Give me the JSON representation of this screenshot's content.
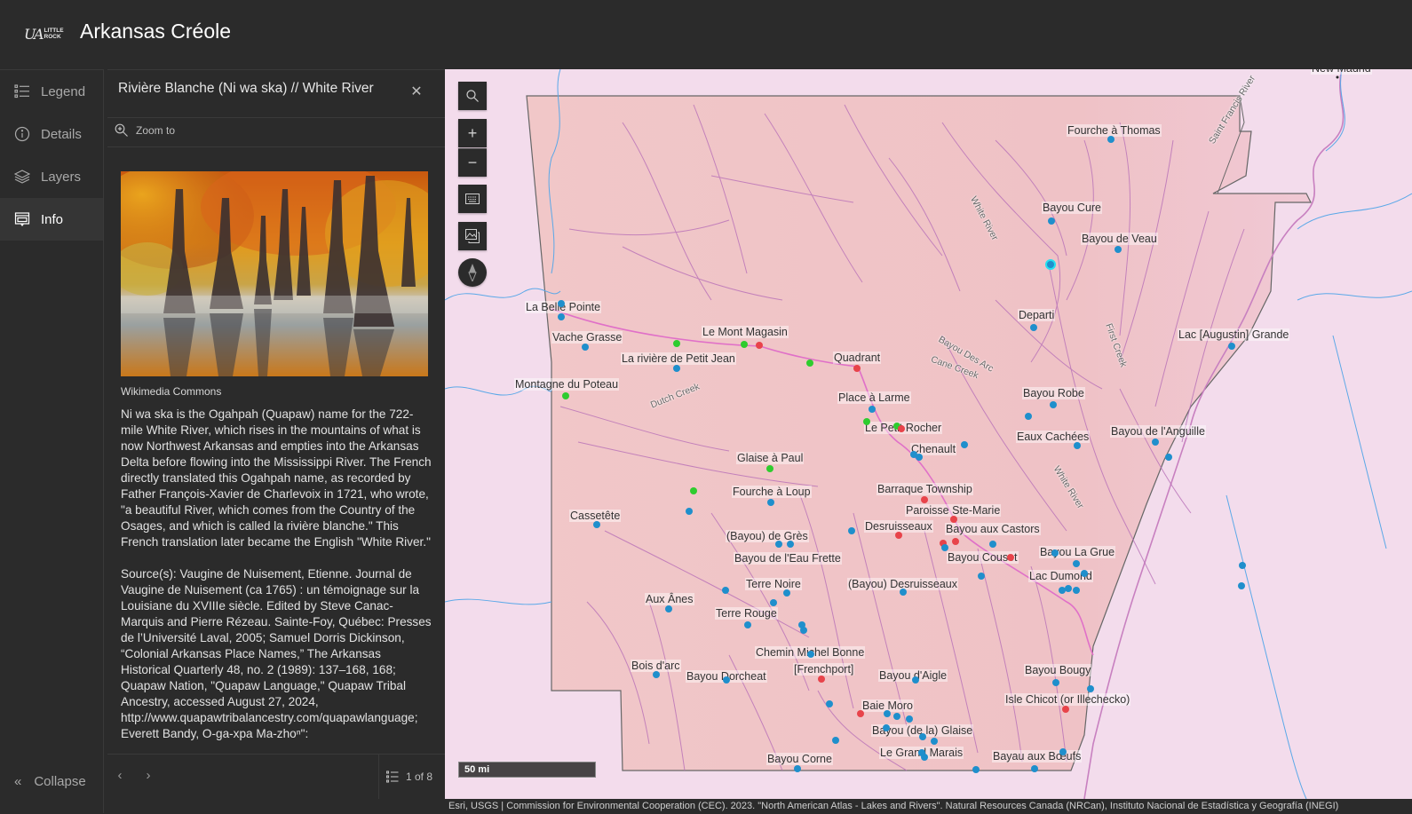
{
  "header": {
    "logo_text_main": "UA",
    "logo_text_top": "LITTLE",
    "logo_text_bottom": "ROCK",
    "title": "Arkansas Créole"
  },
  "action_bar": {
    "items": [
      {
        "label": "Legend",
        "icon": "legend-icon",
        "active": false
      },
      {
        "label": "Details",
        "icon": "info-circle-icon",
        "active": false
      },
      {
        "label": "Layers",
        "icon": "layers-icon",
        "active": false
      },
      {
        "label": "Info",
        "icon": "popup-icon",
        "active": true
      }
    ],
    "collapse_label": "Collapse"
  },
  "panel": {
    "title": "Rivière Blanche (Ni wa ska) // White River",
    "zoom_to_label": "Zoom to",
    "image_credit": "Wikimedia Commons",
    "description": "Ni wa ska is the Ogahpah (Quapaw) name for the 722-mile White River, which rises in the mountains of what is now Northwest Arkansas and empties into the Arkansas Delta before flowing into the Mississippi River. The French directly translated this Ogahpah name, as recorded by Father François-Xavier de Charlevoix in 1721, who wrote, \"a beautiful River, which comes from the Country of the Osages, and which is called la rivière blanche.\" This French translation later became the English \"White River.\"",
    "sources": "Source(s): Vaugine de Nuisement, Etienne. Journal de Vaugine de Nuisement (ca 1765) : un témoignage sur la Louisiane du XVIIIe siècle. Edited by Steve Canac-Marquis and Pierre Rézeau. Sainte-Foy, Québec: Presses de l’Université Laval, 2005; Samuel Dorris Dickinson, “Colonial Arkansas Place Names,” The Arkansas Historical Quarterly 48, no. 2 (1989): 137–168, 168; Quapaw Nation, \"Quapaw Language,\" Quapaw Tribal Ancestry, accessed August 27, 2024, http://www.quapawtribalancestry.com/quapawlanguage; Everett Bandy, O-ga-xpa Ma-zhoⁿ\":",
    "pager": {
      "current": 1,
      "total": 8,
      "text": "1 of 8"
    }
  },
  "map": {
    "controls": [
      "search",
      "zoom-in",
      "zoom-out",
      "keyboard",
      "basemap",
      "compass"
    ],
    "scale_label": "50 mi",
    "attribution": "Esri, USGS | Commission for Environmental Cooperation (CEC). 2023. \"North American Atlas - Lakes and Rivers\". Natural Resources Canada (NRCan), Instituto Nacional de Estadística y Geografía (INEGI)",
    "colors": {
      "blue": "#1f8fcc",
      "green": "#2ecc2e",
      "red": "#e8434a",
      "selected": "#22e0f0",
      "state_fill": "#f0c4c8"
    },
    "places": [
      {
        "name": "New Madrid"
      },
      {
        "name": "Fourche à Thomas"
      },
      {
        "name": "Bayou Cure"
      },
      {
        "name": "Bayou de Veau"
      },
      {
        "name": "La Belle Pointe"
      },
      {
        "name": "Departi"
      },
      {
        "name": "Vache Grasse"
      },
      {
        "name": "Le Mont Magasin"
      },
      {
        "name": "Lac [Augustin] Grande"
      },
      {
        "name": "La rivière de Petit Jean"
      },
      {
        "name": "Quadrant"
      },
      {
        "name": "Montagne du Poteau"
      },
      {
        "name": "Bayou Robe"
      },
      {
        "name": "Place à Larme"
      },
      {
        "name": "Le Petit Rocher"
      },
      {
        "name": "Eaux Cachées"
      },
      {
        "name": "Bayou de l'Anguille"
      },
      {
        "name": "Chenault"
      },
      {
        "name": "Glaise à Paul"
      },
      {
        "name": "Barraque Township"
      },
      {
        "name": "Fourche à Loup"
      },
      {
        "name": "Paroisse Ste-Marie"
      },
      {
        "name": "Cassetête"
      },
      {
        "name": "Desruisseaux"
      },
      {
        "name": "Bayou aux Castors"
      },
      {
        "name": "(Bayou) de Grès"
      },
      {
        "name": "Bayou La Grue"
      },
      {
        "name": "Bayou de l'Eau Frette"
      },
      {
        "name": "Bayou Cousot"
      },
      {
        "name": "Lac Dumond"
      },
      {
        "name": "Terre Noire"
      },
      {
        "name": "(Bayou) Desruisseaux"
      },
      {
        "name": "Aux Ânes"
      },
      {
        "name": "Terre Rouge"
      },
      {
        "name": "Chemin Michel Bonne"
      },
      {
        "name": "Bois d'arc"
      },
      {
        "name": "[Frenchport]"
      },
      {
        "name": "Bayou Bougy"
      },
      {
        "name": "Bayou Dorcheat"
      },
      {
        "name": "Bayou d'Aigle"
      },
      {
        "name": "Isle Chicot (or Illechecko)"
      },
      {
        "name": "Baie Moro"
      },
      {
        "name": "Bayou (de la) Glaise"
      },
      {
        "name": "Le Grand Marais"
      },
      {
        "name": "Bayou Corne"
      },
      {
        "name": "Bayau aux Bœufs"
      }
    ],
    "river_labels": [
      "Saint Francis River",
      "White River",
      "Bayou Des Arc",
      "Cane Creek",
      "First Creek",
      "Dutch Creek",
      "White River"
    ]
  }
}
